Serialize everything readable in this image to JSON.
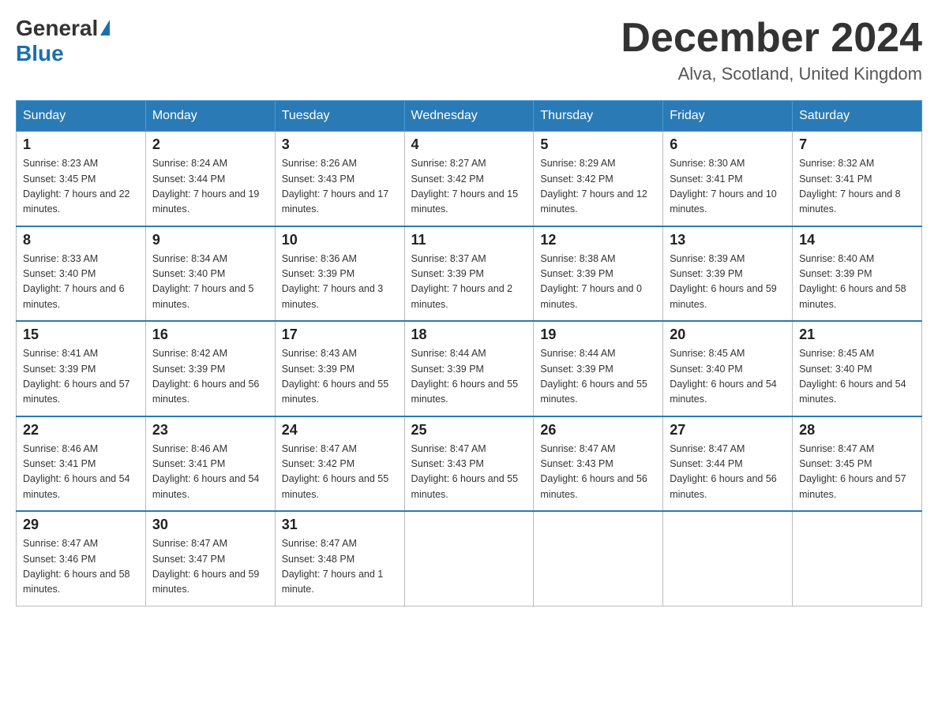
{
  "logo": {
    "general": "General",
    "blue": "Blue"
  },
  "header": {
    "month": "December 2024",
    "location": "Alva, Scotland, United Kingdom"
  },
  "weekdays": [
    "Sunday",
    "Monday",
    "Tuesday",
    "Wednesday",
    "Thursday",
    "Friday",
    "Saturday"
  ],
  "weeks": [
    [
      {
        "day": "1",
        "sunrise": "8:23 AM",
        "sunset": "3:45 PM",
        "daylight": "7 hours and 22 minutes."
      },
      {
        "day": "2",
        "sunrise": "8:24 AM",
        "sunset": "3:44 PM",
        "daylight": "7 hours and 19 minutes."
      },
      {
        "day": "3",
        "sunrise": "8:26 AM",
        "sunset": "3:43 PM",
        "daylight": "7 hours and 17 minutes."
      },
      {
        "day": "4",
        "sunrise": "8:27 AM",
        "sunset": "3:42 PM",
        "daylight": "7 hours and 15 minutes."
      },
      {
        "day": "5",
        "sunrise": "8:29 AM",
        "sunset": "3:42 PM",
        "daylight": "7 hours and 12 minutes."
      },
      {
        "day": "6",
        "sunrise": "8:30 AM",
        "sunset": "3:41 PM",
        "daylight": "7 hours and 10 minutes."
      },
      {
        "day": "7",
        "sunrise": "8:32 AM",
        "sunset": "3:41 PM",
        "daylight": "7 hours and 8 minutes."
      }
    ],
    [
      {
        "day": "8",
        "sunrise": "8:33 AM",
        "sunset": "3:40 PM",
        "daylight": "7 hours and 6 minutes."
      },
      {
        "day": "9",
        "sunrise": "8:34 AM",
        "sunset": "3:40 PM",
        "daylight": "7 hours and 5 minutes."
      },
      {
        "day": "10",
        "sunrise": "8:36 AM",
        "sunset": "3:39 PM",
        "daylight": "7 hours and 3 minutes."
      },
      {
        "day": "11",
        "sunrise": "8:37 AM",
        "sunset": "3:39 PM",
        "daylight": "7 hours and 2 minutes."
      },
      {
        "day": "12",
        "sunrise": "8:38 AM",
        "sunset": "3:39 PM",
        "daylight": "7 hours and 0 minutes."
      },
      {
        "day": "13",
        "sunrise": "8:39 AM",
        "sunset": "3:39 PM",
        "daylight": "6 hours and 59 minutes."
      },
      {
        "day": "14",
        "sunrise": "8:40 AM",
        "sunset": "3:39 PM",
        "daylight": "6 hours and 58 minutes."
      }
    ],
    [
      {
        "day": "15",
        "sunrise": "8:41 AM",
        "sunset": "3:39 PM",
        "daylight": "6 hours and 57 minutes."
      },
      {
        "day": "16",
        "sunrise": "8:42 AM",
        "sunset": "3:39 PM",
        "daylight": "6 hours and 56 minutes."
      },
      {
        "day": "17",
        "sunrise": "8:43 AM",
        "sunset": "3:39 PM",
        "daylight": "6 hours and 55 minutes."
      },
      {
        "day": "18",
        "sunrise": "8:44 AM",
        "sunset": "3:39 PM",
        "daylight": "6 hours and 55 minutes."
      },
      {
        "day": "19",
        "sunrise": "8:44 AM",
        "sunset": "3:39 PM",
        "daylight": "6 hours and 55 minutes."
      },
      {
        "day": "20",
        "sunrise": "8:45 AM",
        "sunset": "3:40 PM",
        "daylight": "6 hours and 54 minutes."
      },
      {
        "day": "21",
        "sunrise": "8:45 AM",
        "sunset": "3:40 PM",
        "daylight": "6 hours and 54 minutes."
      }
    ],
    [
      {
        "day": "22",
        "sunrise": "8:46 AM",
        "sunset": "3:41 PM",
        "daylight": "6 hours and 54 minutes."
      },
      {
        "day": "23",
        "sunrise": "8:46 AM",
        "sunset": "3:41 PM",
        "daylight": "6 hours and 54 minutes."
      },
      {
        "day": "24",
        "sunrise": "8:47 AM",
        "sunset": "3:42 PM",
        "daylight": "6 hours and 55 minutes."
      },
      {
        "day": "25",
        "sunrise": "8:47 AM",
        "sunset": "3:43 PM",
        "daylight": "6 hours and 55 minutes."
      },
      {
        "day": "26",
        "sunrise": "8:47 AM",
        "sunset": "3:43 PM",
        "daylight": "6 hours and 56 minutes."
      },
      {
        "day": "27",
        "sunrise": "8:47 AM",
        "sunset": "3:44 PM",
        "daylight": "6 hours and 56 minutes."
      },
      {
        "day": "28",
        "sunrise": "8:47 AM",
        "sunset": "3:45 PM",
        "daylight": "6 hours and 57 minutes."
      }
    ],
    [
      {
        "day": "29",
        "sunrise": "8:47 AM",
        "sunset": "3:46 PM",
        "daylight": "6 hours and 58 minutes."
      },
      {
        "day": "30",
        "sunrise": "8:47 AM",
        "sunset": "3:47 PM",
        "daylight": "6 hours and 59 minutes."
      },
      {
        "day": "31",
        "sunrise": "8:47 AM",
        "sunset": "3:48 PM",
        "daylight": "7 hours and 1 minute."
      },
      null,
      null,
      null,
      null
    ]
  ]
}
